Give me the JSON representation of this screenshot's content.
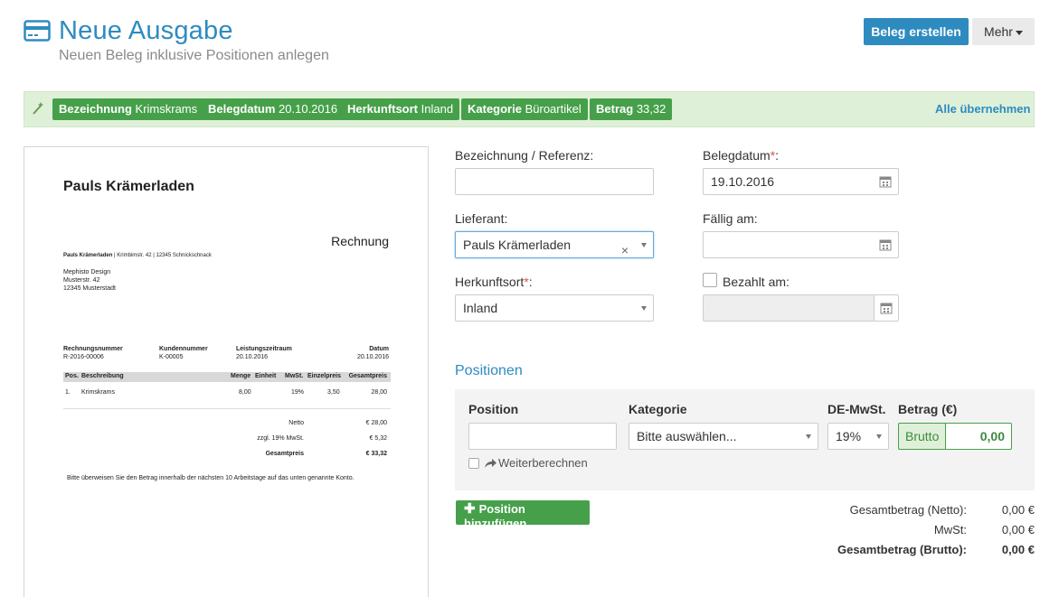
{
  "header": {
    "title": "Neue Ausgabe",
    "subtitle": "Neuen Beleg inklusive Positionen anlegen",
    "create_button": "Beleg erstellen",
    "more_button": "Mehr"
  },
  "suggestions": {
    "tags": [
      {
        "label": "Bezeichnung",
        "value": "Krimskrams"
      },
      {
        "label": "Belegdatum",
        "value": "20.10.2016"
      },
      {
        "label": "Herkunftsort",
        "value": "Inland"
      },
      {
        "label": "Kategorie",
        "value": "Büroartikel"
      },
      {
        "label": "Betrag",
        "value": "33,32"
      }
    ],
    "apply_all": "Alle übernehmen"
  },
  "document": {
    "shop_name": "Pauls Krämerladen",
    "doc_type": "Rechnung",
    "sender_name": "Pauls Krämerladen",
    "sender_address": " | Krimbimstr. 42 | 12345 Schnickschnack",
    "recipient": [
      "Mephisto Design",
      "Musterstr. 42",
      "12345 Musterstadt"
    ],
    "meta_headers": [
      "Rechnungsnummer",
      "Kundennummer",
      "Leistungszeitraum",
      "Datum"
    ],
    "meta_values": [
      "R-2016-00006",
      "K-00005",
      "20.10.2016",
      "20.10.2016"
    ],
    "table_headers": [
      "Pos.",
      "Beschreibung",
      "Menge",
      "Einheit",
      "MwSt.",
      "Einzelpreis",
      "Gesamtpreis"
    ],
    "row": [
      "1.",
      "Krimskrams",
      "8,00",
      "19%",
      "3,50",
      "28,00"
    ],
    "totals": [
      {
        "label": "Netto",
        "value": "€ 28,00"
      },
      {
        "label": "zzgl. 19% MwSt.",
        "value": "€ 5,32"
      },
      {
        "label": "Gesamtpreis",
        "value": "€ 33,32"
      }
    ],
    "footer_note": "Bitte überweisen Sie den Betrag innerhalb der nächsten 10 Arbeitstage auf das unten genannte Konto."
  },
  "form": {
    "reference_label": "Bezeichnung / Referenz:",
    "reference_value": "",
    "date_label": "Belegdatum",
    "date_value": "19.10.2016",
    "supplier_label": "Lieferant:",
    "supplier_value": "Pauls Krämerladen",
    "due_label": "Fällig am:",
    "due_value": "",
    "origin_label": "Herkunftsort",
    "origin_value": "Inland",
    "paid_label": "Bezahlt am:",
    "paid_value": "",
    "required_mark": "*",
    "colon": ":"
  },
  "positions": {
    "title": "Positionen",
    "col_position": "Position",
    "col_category": "Kategorie",
    "col_vat": "DE-MwSt.",
    "col_amount": "Betrag (€)",
    "position_value": "",
    "category_placeholder": "Bitte auswählen...",
    "vat_value": "19%",
    "brutto_label": "Brutto",
    "amount_value": "0,00",
    "recalc_label": "Weiterberechnen",
    "add_button": "Position hinzufügen"
  },
  "summary": {
    "net_label": "Gesamtbetrag (Netto):",
    "net_value": "0,00 €",
    "vat_label": "MwSt:",
    "vat_value": "0,00 €",
    "gross_label": "Gesamtbetrag (Brutto):",
    "gross_value": "0,00 €"
  },
  "colors": {
    "accent": "#2e8bc0",
    "success": "#46a04a",
    "success_bg": "#dff0d8",
    "required": "#d9534f"
  }
}
